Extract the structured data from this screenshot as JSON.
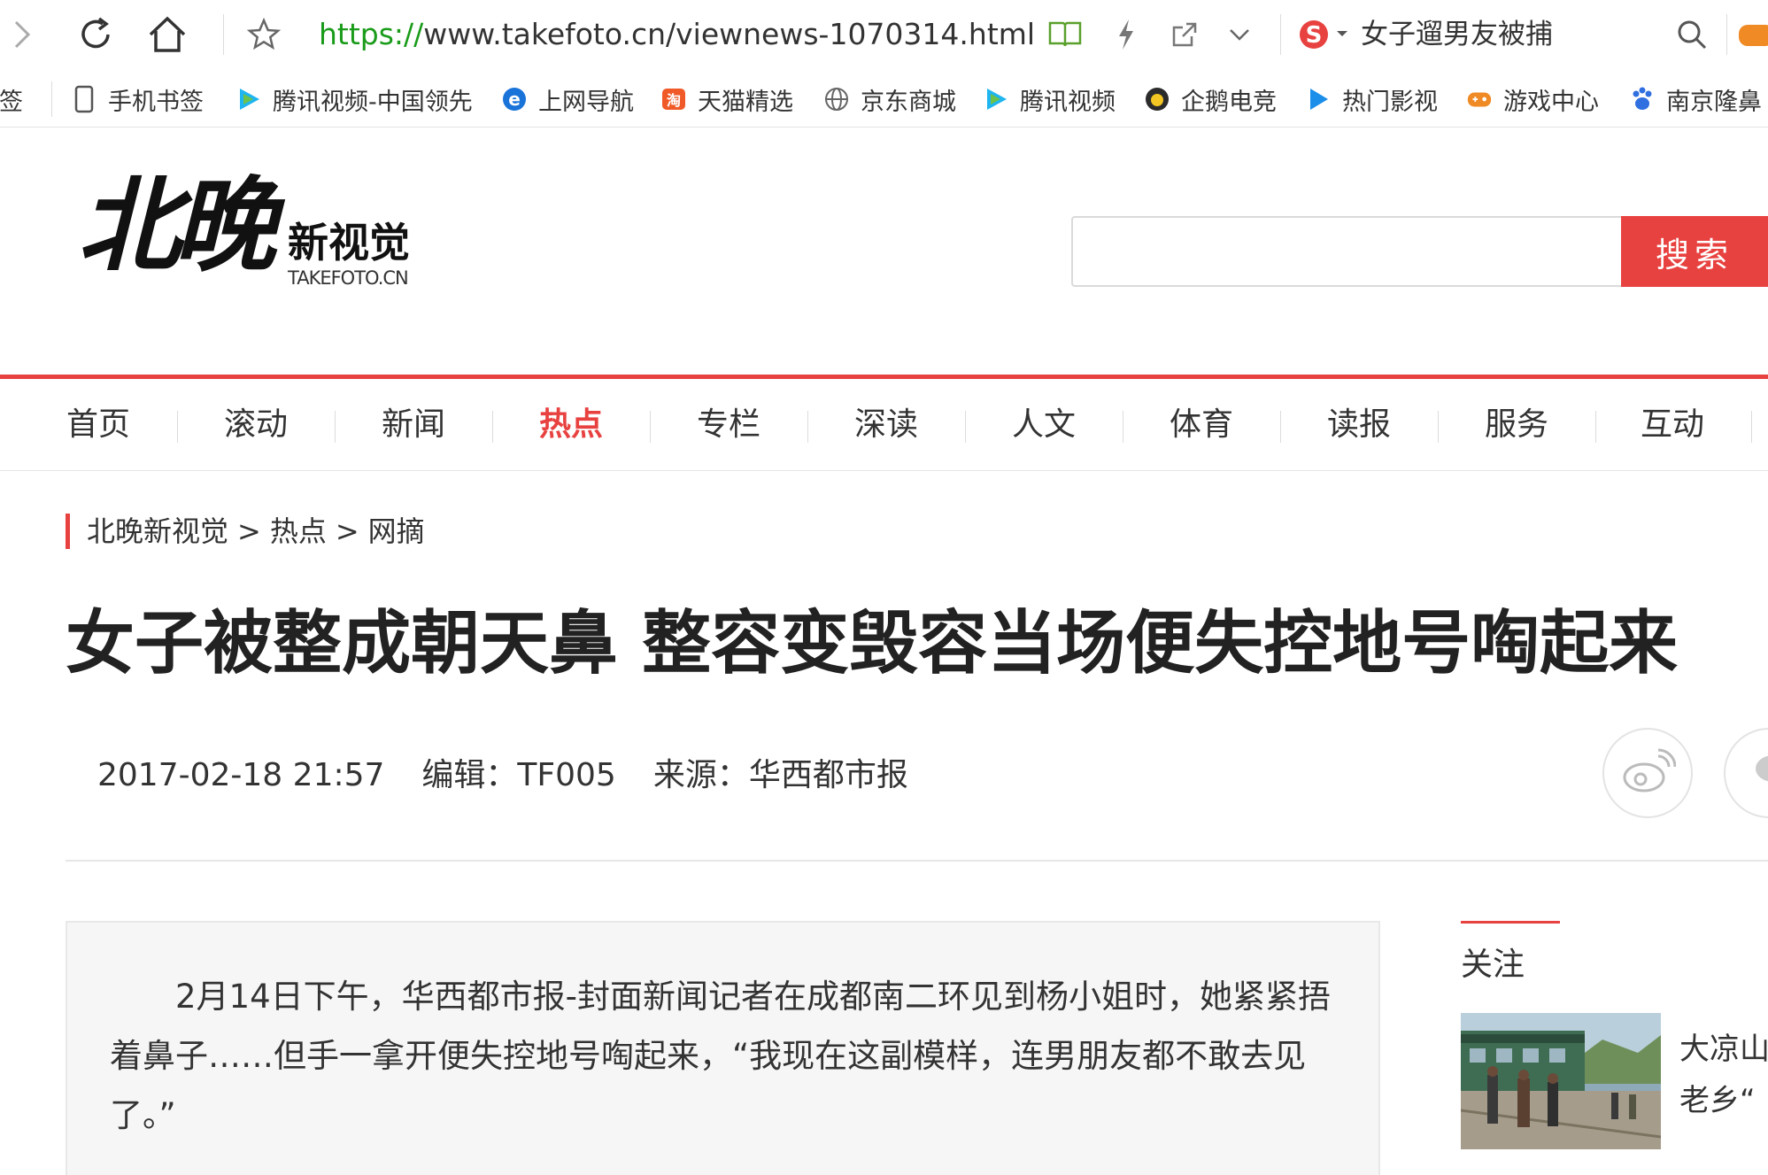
{
  "browser": {
    "url_scheme": "https://",
    "url_rest": "www.takefoto.cn/viewnews-1070314.html",
    "search_query": "女子遛男友被捕",
    "bookmarks": [
      {
        "label": "书签",
        "icon": "bookmark-icon"
      },
      {
        "label": "手机书签",
        "icon": "phone-icon"
      },
      {
        "label": "腾讯视频-中国领先",
        "icon": "tencent-video-icon"
      },
      {
        "label": "上网导航",
        "icon": "ie-icon"
      },
      {
        "label": "天猫精选",
        "icon": "tmall-icon"
      },
      {
        "label": "京东商城",
        "icon": "globe-icon"
      },
      {
        "label": "腾讯视频",
        "icon": "tencent-video-icon"
      },
      {
        "label": "企鹅电竞",
        "icon": "penguin-esports-icon"
      },
      {
        "label": "热门影视",
        "icon": "play-icon"
      },
      {
        "label": "游戏中心",
        "icon": "gamepad-icon"
      },
      {
        "label": "南京隆鼻",
        "icon": "baidu-paw-icon"
      }
    ]
  },
  "site": {
    "logo_main": "北晚",
    "logo_sub": "新视觉",
    "logo_domain": "TAKEFOTO.CN",
    "search_button": "搜索",
    "nav": [
      "首页",
      "滚动",
      "新闻",
      "热点",
      "专栏",
      "深读",
      "人文",
      "体育",
      "读报",
      "服务",
      "互动"
    ],
    "nav_active": "热点"
  },
  "article": {
    "breadcrumb": [
      "北晚新视觉",
      "热点",
      "网摘"
    ],
    "breadcrumb_sep": ">",
    "title": "女子被整成朝天鼻 整容变毁容当场便失控地号啕起来",
    "date": "2017-02-18 21:57",
    "editor": "编辑：TF005",
    "source": "来源：华西都市报",
    "summary": "2月14日下午，华西都市报-封面新闻记者在成都南二环见到杨小姐时，她紧紧捂着鼻子……但手一拿开便失控地号啕起来，“我现在这副模样，连男朋友都不敢去见了。”"
  },
  "sidebar": {
    "title": "关注",
    "item_text_line1": "大凉山",
    "item_text_line2": "老乡“"
  },
  "colors": {
    "accent": "#e84240",
    "url_scheme": "#1a9b1a"
  }
}
